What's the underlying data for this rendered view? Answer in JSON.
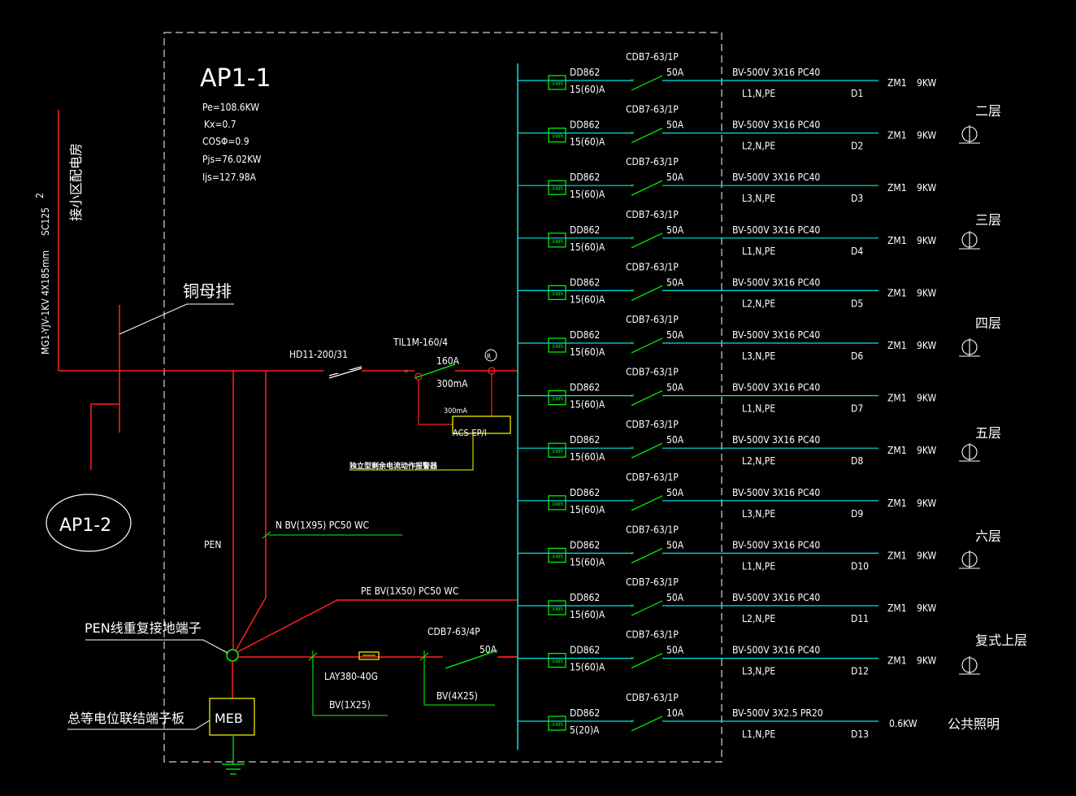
{
  "panel": {
    "name": "AP1-1",
    "params": [
      "Pe=108.6KW",
      "Kx=0.7",
      "COSΦ=0.9",
      "Pjs=76.02KW",
      "Ijs=127.98A"
    ]
  },
  "incoming": {
    "cable": "MG1-YJV-1KV 4X185mm",
    "conduit": "SC125",
    "conduit_count": "2",
    "source": "接小区配电房",
    "busbar_label": "铜母排",
    "sub_panel": "AP1-2"
  },
  "main": {
    "switch": "HD11-200/31",
    "breaker": "TIL1M-160/4",
    "rating": "160A",
    "leakage": "300mA",
    "monitor_rating": "300mA",
    "monitor_model": "ACS-EP/I",
    "monitor_note": "独立型剩余电流动作报警器",
    "monitor_symbol": "R"
  },
  "grounding": {
    "pen_label": "PEN",
    "n_label": "N BV(1X95) PC50 WC",
    "pe_label": "PE BV(1X50) PC50 WC",
    "pen_terminal": "PEN线重复接地端子",
    "meb_box": "MEB",
    "meb_label": "总等电位联结端子板"
  },
  "spd": {
    "breaker": "CDB7-63/4P",
    "rating": "50A",
    "protector": "LAY380-40G",
    "wire1": "BV(1X25)",
    "wire2": "BV(4X25)"
  },
  "circuits": [
    {
      "meter": "DD862",
      "meter_rating": "15(60)A",
      "breaker": "CDB7-63/1P",
      "rating": "50A",
      "cable": "BV-500V 3X16 PC40",
      "phases": "L1,N,PE",
      "id": "D1",
      "load": "ZM1",
      "power": "9KW"
    },
    {
      "meter": "DD862",
      "meter_rating": "15(60)A",
      "breaker": "CDB7-63/1P",
      "rating": "50A",
      "cable": "BV-500V 3X16 PC40",
      "phases": "L2,N,PE",
      "id": "D2",
      "load": "ZM1",
      "power": "9KW"
    },
    {
      "meter": "DD862",
      "meter_rating": "15(60)A",
      "breaker": "CDB7-63/1P",
      "rating": "50A",
      "cable": "BV-500V 3X16 PC40",
      "phases": "L3,N,PE",
      "id": "D3",
      "load": "ZM1",
      "power": "9KW"
    },
    {
      "meter": "DD862",
      "meter_rating": "15(60)A",
      "breaker": "CDB7-63/1P",
      "rating": "50A",
      "cable": "BV-500V 3X16 PC40",
      "phases": "L1,N,PE",
      "id": "D4",
      "load": "ZM1",
      "power": "9KW"
    },
    {
      "meter": "DD862",
      "meter_rating": "15(60)A",
      "breaker": "CDB7-63/1P",
      "rating": "50A",
      "cable": "BV-500V 3X16 PC40",
      "phases": "L2,N,PE",
      "id": "D5",
      "load": "ZM1",
      "power": "9KW"
    },
    {
      "meter": "DD862",
      "meter_rating": "15(60)A",
      "breaker": "CDB7-63/1P",
      "rating": "50A",
      "cable": "BV-500V 3X16 PC40",
      "phases": "L3,N,PE",
      "id": "D6",
      "load": "ZM1",
      "power": "9KW"
    },
    {
      "meter": "DD862",
      "meter_rating": "15(60)A",
      "breaker": "CDB7-63/1P",
      "rating": "50A",
      "cable": "BV-500V 3X16 PC40",
      "phases": "L1,N,PE",
      "id": "D7",
      "load": "ZM1",
      "power": "9KW"
    },
    {
      "meter": "DD862",
      "meter_rating": "15(60)A",
      "breaker": "CDB7-63/1P",
      "rating": "50A",
      "cable": "BV-500V 3X16 PC40",
      "phases": "L2,N,PE",
      "id": "D8",
      "load": "ZM1",
      "power": "9KW"
    },
    {
      "meter": "DD862",
      "meter_rating": "15(60)A",
      "breaker": "CDB7-63/1P",
      "rating": "50A",
      "cable": "BV-500V 3X16 PC40",
      "phases": "L3,N,PE",
      "id": "D9",
      "load": "ZM1",
      "power": "9KW"
    },
    {
      "meter": "DD862",
      "meter_rating": "15(60)A",
      "breaker": "CDB7-63/1P",
      "rating": "50A",
      "cable": "BV-500V 3X16 PC40",
      "phases": "L1,N,PE",
      "id": "D10",
      "load": "ZM1",
      "power": "9KW"
    },
    {
      "meter": "DD862",
      "meter_rating": "15(60)A",
      "breaker": "CDB7-63/1P",
      "rating": "50A",
      "cable": "BV-500V 3X16 PC40",
      "phases": "L2,N,PE",
      "id": "D11",
      "load": "ZM1",
      "power": "9KW"
    },
    {
      "meter": "DD862",
      "meter_rating": "15(60)A",
      "breaker": "CDB7-63/1P",
      "rating": "50A",
      "cable": "BV-500V 3X16 PC40",
      "phases": "L3,N,PE",
      "id": "D12",
      "load": "ZM1",
      "power": "9KW"
    },
    {
      "meter": "DD862",
      "meter_rating": "5(20)A",
      "breaker": "CDB7-63/1P",
      "rating": "10A",
      "cable": "BV-500V 3X2.5 PR20",
      "phases": "L1,N,PE",
      "id": "D13",
      "load": "0.6KW",
      "power": ""
    }
  ],
  "floors": [
    "二层",
    "三层",
    "四层",
    "五层",
    "六层",
    "复式上层"
  ],
  "public_lighting": "公共照明",
  "meter_symbol": "kWh",
  "colors": {
    "background": "#000000",
    "feeder": "#00e5e5",
    "power": "#ff2020",
    "device": "#00ff00",
    "annotation": "#ffff00",
    "text": "#ffffff"
  }
}
